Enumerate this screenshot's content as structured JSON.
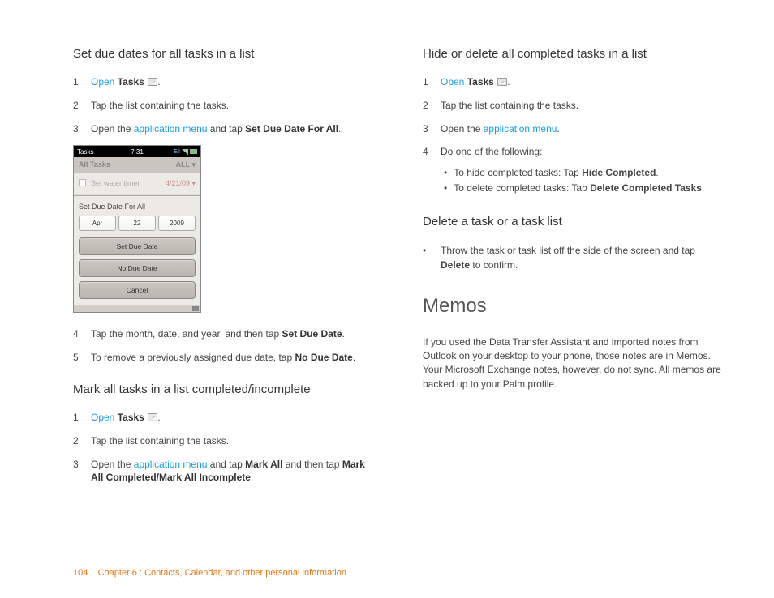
{
  "left": {
    "s1": {
      "heading": "Set due dates for all tasks in a list",
      "step1_open": "Open",
      "step1_tasks": "Tasks",
      "step1_dot": ".",
      "step2": "Tap the list containing the tasks.",
      "step3_a": "Open the ",
      "step3_link": "application menu",
      "step3_b": " and tap ",
      "step3_bold": "Set Due Date For All",
      "step3_dot": ".",
      "step4_a": "Tap the month, date, and year, and then tap ",
      "step4_bold": "Set Due Date",
      "step4_dot": ".",
      "step5_a": "To remove a previously assigned due date, tap ",
      "step5_bold": "No Due Date",
      "step5_dot": "."
    },
    "phone": {
      "sb_app": "Tasks",
      "sb_time": "7:31",
      "hdr_left": "All Tasks",
      "hdr_right": "ALL ▾",
      "row1": "Set water timer",
      "row1_date": "4/21/09 ▾",
      "popup_title": "Set Due Date For All",
      "d_m": "Apr",
      "d_d": "22",
      "d_y": "2009",
      "btn1": "Set Due Date",
      "btn2": "No Due Date",
      "btn3": "Cancel"
    },
    "s2": {
      "heading": "Mark all tasks in a list completed/incomplete",
      "step1_open": "Open",
      "step1_tasks": "Tasks",
      "step1_dot": ".",
      "step2": "Tap the list containing the tasks.",
      "step3_a": "Open the ",
      "step3_link": "application menu",
      "step3_b": " and tap ",
      "step3_bold1": "Mark All",
      "step3_c": " and then tap ",
      "step3_bold2": "Mark All Completed/Mark All Incomplete",
      "step3_dot": "."
    }
  },
  "right": {
    "s3": {
      "heading": "Hide or delete all completed tasks in a list",
      "step1_open": "Open",
      "step1_tasks": "Tasks",
      "step1_dot": ".",
      "step2": "Tap the list containing the tasks.",
      "step3_a": "Open the ",
      "step3_link": "application menu",
      "step3_dot": ".",
      "step4": "Do one of the following:",
      "b1_a": "To hide completed tasks: Tap ",
      "b1_bold": "Hide Completed",
      "b1_dot": ".",
      "b2_a": "To delete completed tasks: Tap ",
      "b2_bold": "Delete Completed Tasks",
      "b2_dot": "."
    },
    "s4": {
      "heading": "Delete a task or a task list",
      "b_a": "Throw the task or task list off the side of the screen and tap ",
      "b_bold": "Delete",
      "b_b": " to confirm."
    },
    "memos": {
      "heading": "Memos",
      "para": "If you used the Data Transfer Assistant and imported notes from Outlook on your desktop to your phone, those notes are in Memos. Your Microsoft Exchange notes, however, do not sync. All memos are backed up to your Palm profile."
    }
  },
  "footer": {
    "page": "104",
    "chapter": "Chapter 6 : Contacts, Calendar, and other personal information"
  }
}
